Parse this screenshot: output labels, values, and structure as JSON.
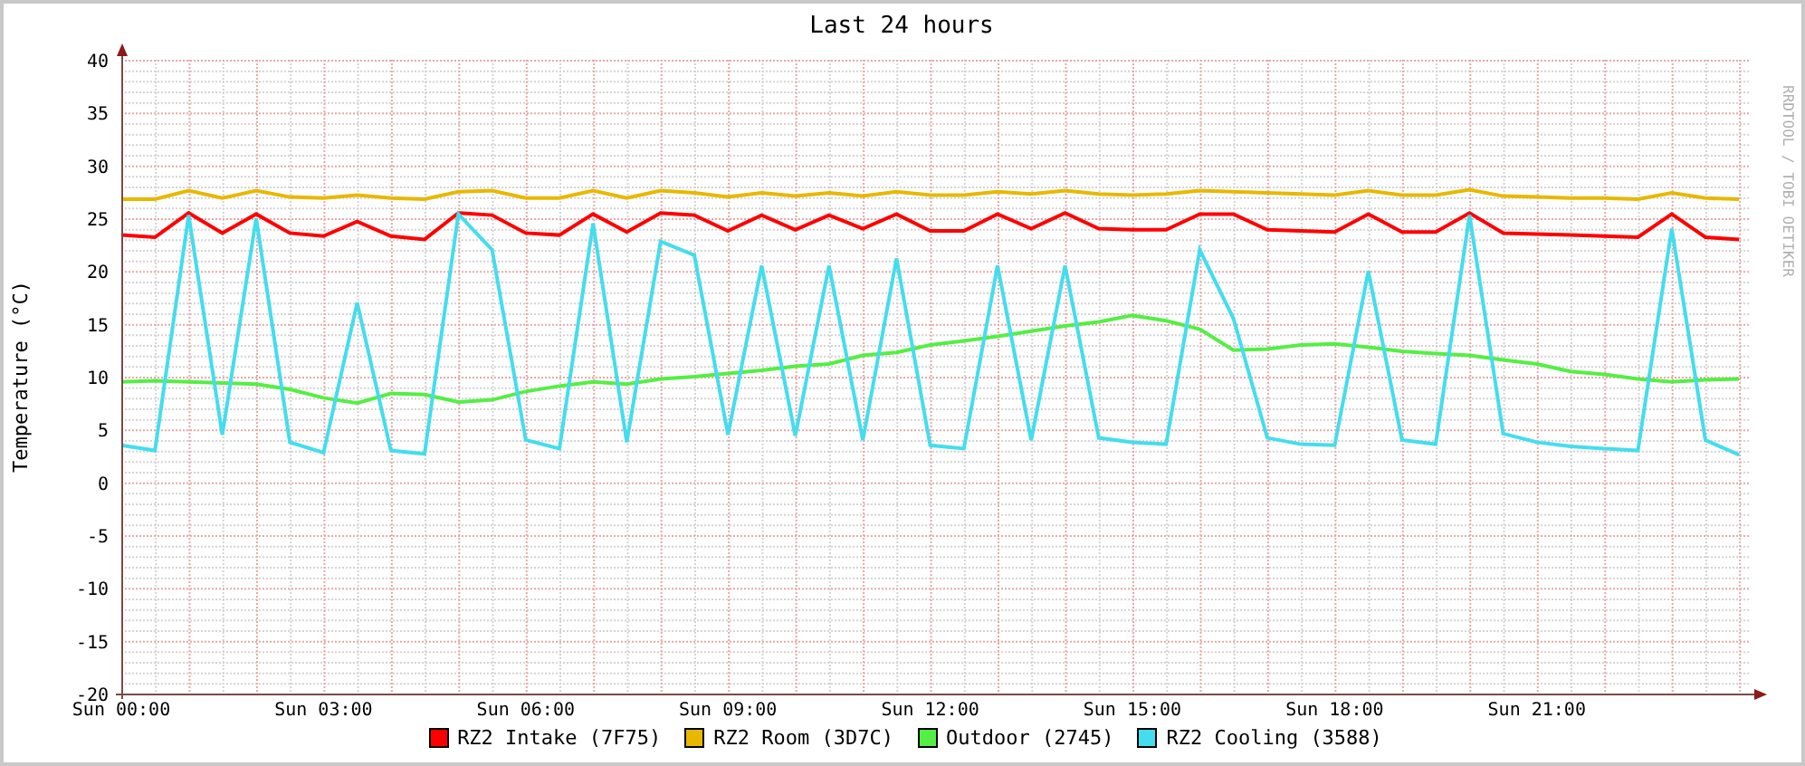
{
  "graph": {
    "credit": "RRDTOOL / TOBI OETIKER",
    "chart_data": {
      "type": "line",
      "title": "Last 24 hours",
      "ylabel": "Temperature (°C)",
      "categories": [
        "Sun 00:00",
        null,
        null,
        null,
        null,
        null,
        "Sun 03:00",
        null,
        null,
        null,
        null,
        null,
        "Sun 06:00",
        null,
        null,
        null,
        null,
        null,
        "Sun 09:00",
        null,
        null,
        null,
        null,
        null,
        "Sun 12:00",
        null,
        null,
        null,
        null,
        null,
        "Sun 15:00",
        null,
        null,
        null,
        null,
        null,
        "Sun 18:00",
        null,
        null,
        null,
        null,
        null,
        "Sun 21:00",
        null,
        null,
        null,
        null,
        null,
        null
      ],
      "ylim": [
        -20,
        40
      ],
      "grid": true,
      "yticks": [
        -20,
        -15,
        -10,
        -5,
        0,
        5,
        10,
        15,
        20,
        25,
        30,
        35,
        40
      ],
      "series": [
        {
          "name": "RZ2 Intake (7F75)",
          "color": "#ff0000",
          "values": [
            23.4,
            23.2,
            25.5,
            23.6,
            25.4,
            23.6,
            23.3,
            24.7,
            23.3,
            23.0,
            25.5,
            25.3,
            23.6,
            23.4,
            25.4,
            23.7,
            25.5,
            25.3,
            23.8,
            25.3,
            23.9,
            25.3,
            24.0,
            25.4,
            23.8,
            23.8,
            25.4,
            24.0,
            25.5,
            24.0,
            23.9,
            23.9,
            25.4,
            25.4,
            23.9,
            23.8,
            23.7,
            25.4,
            23.7,
            23.7,
            25.5,
            23.6,
            23.5,
            23.4,
            23.3,
            23.2,
            25.4,
            23.2,
            23.0
          ]
        },
        {
          "name": "RZ2 Room (3D7C)",
          "color": "#e8b800",
          "values": [
            26.8,
            26.8,
            27.6,
            26.9,
            27.6,
            27.0,
            26.9,
            27.2,
            26.9,
            26.8,
            27.5,
            27.6,
            26.9,
            26.9,
            27.6,
            26.9,
            27.6,
            27.4,
            27.0,
            27.4,
            27.1,
            27.4,
            27.1,
            27.5,
            27.2,
            27.2,
            27.5,
            27.3,
            27.6,
            27.3,
            27.2,
            27.3,
            27.6,
            27.5,
            27.4,
            27.3,
            27.2,
            27.6,
            27.2,
            27.2,
            27.7,
            27.1,
            27.0,
            26.9,
            26.9,
            26.8,
            27.4,
            26.9,
            26.8
          ]
        },
        {
          "name": "Outdoor (2745)",
          "color": "#55ee44",
          "values": [
            9.5,
            9.6,
            9.5,
            9.4,
            9.3,
            8.8,
            8.0,
            7.5,
            8.4,
            8.3,
            7.6,
            7.8,
            8.6,
            9.1,
            9.5,
            9.3,
            9.8,
            10.0,
            10.3,
            10.6,
            11.0,
            11.2,
            12.0,
            12.3,
            13.0,
            13.4,
            13.8,
            14.3,
            14.8,
            15.2,
            15.8,
            15.3,
            14.5,
            12.5,
            12.6,
            13.0,
            13.1,
            12.8,
            12.4,
            12.2,
            12.0,
            11.6,
            11.2,
            10.5,
            10.2,
            9.8,
            9.5,
            9.7,
            9.8
          ]
        },
        {
          "name": "RZ2 Cooling (3588)",
          "color": "#44ddee",
          "values": [
            3.5,
            3.0,
            25.3,
            4.5,
            25.0,
            3.8,
            2.8,
            17.0,
            3.0,
            2.7,
            25.4,
            22.0,
            4.0,
            3.2,
            24.5,
            3.8,
            22.8,
            21.5,
            4.5,
            20.5,
            4.4,
            20.5,
            4.0,
            21.2,
            3.5,
            3.2,
            20.5,
            4.0,
            20.5,
            4.2,
            3.8,
            3.6,
            22.0,
            15.5,
            4.2,
            3.6,
            3.5,
            20.0,
            4.0,
            3.6,
            25.3,
            4.6,
            3.8,
            3.4,
            3.2,
            3.0,
            24.0,
            4.0,
            2.6
          ]
        }
      ]
    }
  }
}
